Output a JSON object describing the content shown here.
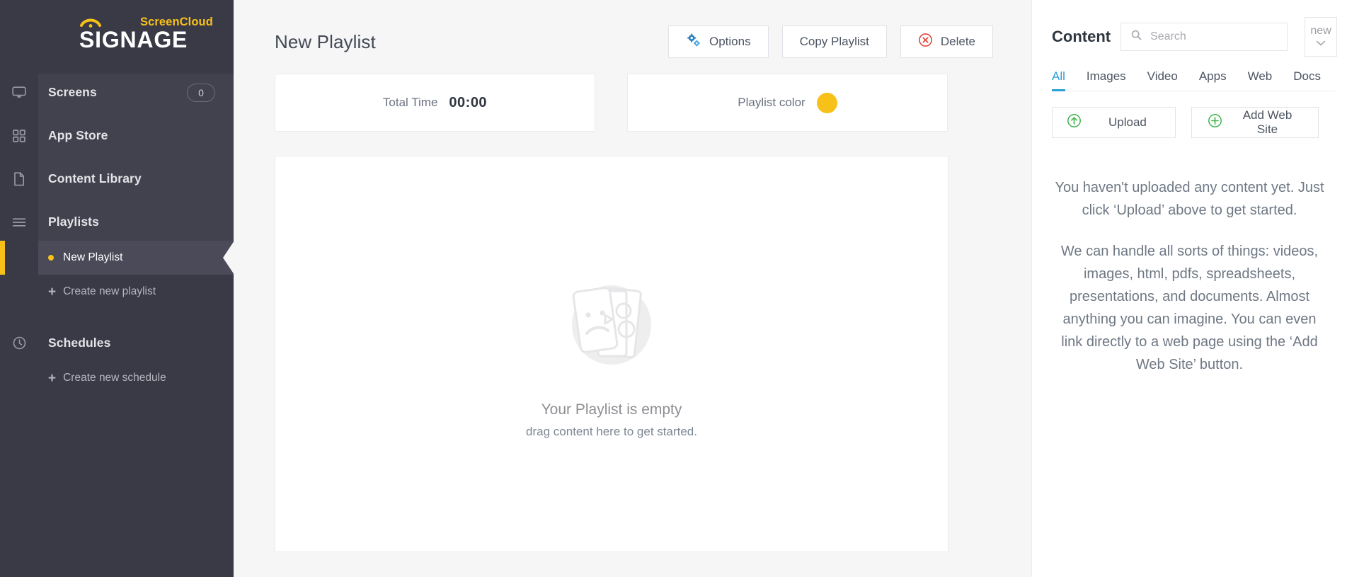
{
  "brand": {
    "name": "ScreenCloud",
    "product": "SIGNAGE",
    "accent_color": "#f7c11a",
    "sidebar_bg": "#3a3a47"
  },
  "sidebar": {
    "items": [
      {
        "label": "Screens",
        "icon": "monitor-icon",
        "badge": "0"
      },
      {
        "label": "App Store",
        "icon": "grid-icon",
        "badge": ""
      },
      {
        "label": "Content Library",
        "icon": "document-icon",
        "badge": ""
      },
      {
        "label": "Playlists",
        "icon": "list-icon",
        "badge": ""
      }
    ],
    "playlist_item": {
      "label": "New Playlist",
      "active": true
    },
    "create_playlist": {
      "label": "Create new playlist",
      "plus": "+"
    },
    "schedules": {
      "label": "Schedules",
      "icon": "clock-icon"
    },
    "create_schedule": {
      "label": "Create new schedule",
      "plus": "+"
    }
  },
  "main": {
    "page_title": "New Playlist",
    "actions": [
      {
        "label": "Options",
        "icon": "gears-icon",
        "color": "#2a7fc1"
      },
      {
        "label": "Copy Playlist",
        "icon": "",
        "color": ""
      },
      {
        "label": "Delete",
        "icon": "delete-circle-icon",
        "color": "#e0463c"
      }
    ],
    "total_time": {
      "label": "Total Time",
      "value": "00:00"
    },
    "playlist_color": {
      "label": "Playlist color",
      "value": "#f7c11a"
    },
    "empty_state": {
      "title": "Your Playlist is empty",
      "subtitle": "drag content here to get started.",
      "illustration": "sad-media-cards-icon"
    }
  },
  "content_panel": {
    "title": "Content",
    "search": {
      "placeholder": "Search",
      "value": "",
      "icon": "search-icon"
    },
    "new_button": {
      "label": "new",
      "icon": "chevron-down-icon"
    },
    "tabs": [
      {
        "label": "All",
        "active": true
      },
      {
        "label": "Images",
        "active": false
      },
      {
        "label": "Video",
        "active": false
      },
      {
        "label": "Apps",
        "active": false
      },
      {
        "label": "Web",
        "active": false
      },
      {
        "label": "Docs",
        "active": false
      }
    ],
    "tab_accent_color": "#2a9fd6",
    "buttons": [
      {
        "label": "Upload",
        "icon": "upload-circle-icon",
        "color": "#3fb54a"
      },
      {
        "label": "Add Web Site",
        "icon": "plus-circle-icon",
        "color": "#3fb54a"
      }
    ],
    "empty_state": {
      "paragraph_1": "You haven't uploaded any content yet. Just click ‘Upload’ above to get started.",
      "paragraph_2": "We can handle all sorts of things: videos, images, html, pdfs, spreadsheets, presentations, and documents. Almost anything you can imagine. You can even link directly to a web page using the ‘Add Web Site’ button."
    }
  }
}
